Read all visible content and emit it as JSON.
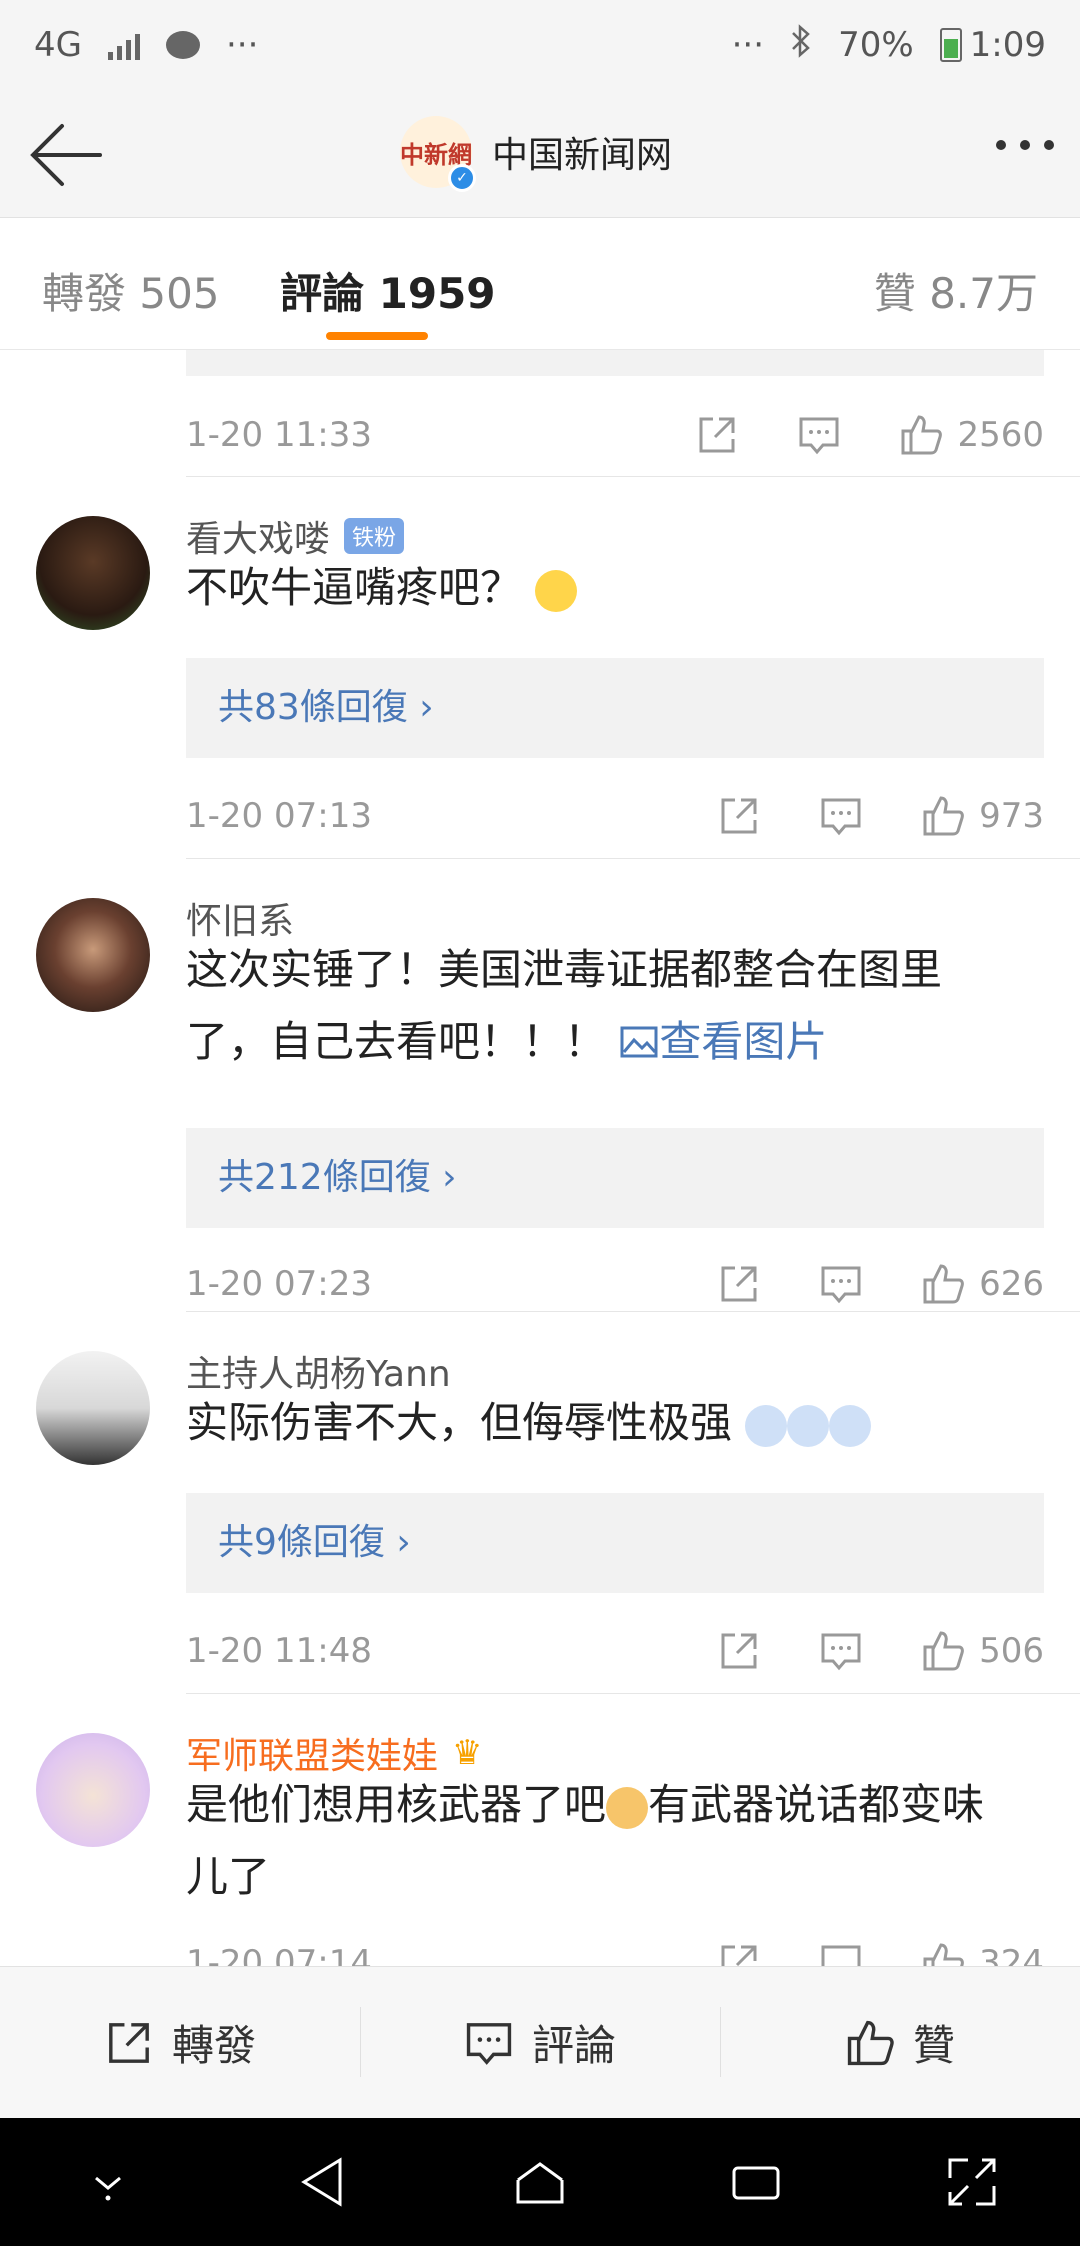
{
  "status": {
    "network": "4G",
    "dots_left": "···",
    "dots_right": "···",
    "battery_percent": "70%",
    "time": "1:09"
  },
  "header": {
    "title": "中国新闻网",
    "logo_text": "中新網"
  },
  "tabs": [
    {
      "label": "轉發 505",
      "active": false
    },
    {
      "label": "評論 1959",
      "active": true
    },
    {
      "label": "贊 8.7万",
      "active": false
    }
  ],
  "prev": {
    "time": "1-20 11:33",
    "likes": "2560"
  },
  "comments": [
    {
      "name": "看大戏喽",
      "badge": "铁粉",
      "text": "不吹牛逼嘴疼吧？",
      "replies": "共83條回復 ›",
      "time": "1-20 07:13",
      "likes": "973"
    },
    {
      "name": "怀旧系",
      "text_line1": "这次实锤了！美国泄毒证据都整合在图里",
      "text_line2": "了，自己去看吧！！！",
      "link": "查看图片",
      "replies": "共212條回復 ›",
      "time": "1-20 07:23",
      "likes": "626"
    },
    {
      "name": "主持人胡杨Yann",
      "text": "实际伤害不大，但侮辱性极强",
      "replies": "共9條回復 ›",
      "time": "1-20 11:48",
      "likes": "506"
    },
    {
      "name": "军师联盟类娃娃",
      "text_a": "是他们想用核武器了吧",
      "text_b": "有武器说话都变味",
      "text_line2": "儿了",
      "time": "1-20 07:14",
      "likes": "324"
    }
  ],
  "bottom": {
    "repost": "轉發",
    "comment": "評論",
    "like": "贊"
  }
}
